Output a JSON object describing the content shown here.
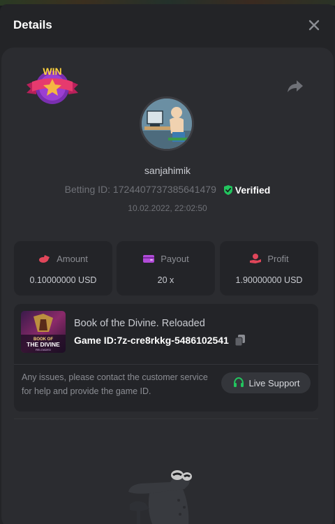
{
  "header": {
    "title": "Details"
  },
  "player": {
    "username": "sanjahimik",
    "betting_id_label": "Betting ID:",
    "betting_id": "1724407737385641479",
    "verified_label": "Verified",
    "timestamp": "10.02.2022, 22:02:50"
  },
  "stats": [
    {
      "label": "Amount",
      "value": "0.10000000 USD",
      "icon": "coins-icon",
      "color": "#e0465a"
    },
    {
      "label": "Payout",
      "value": "20 x",
      "icon": "wallet-icon",
      "color": "#b14bd8"
    },
    {
      "label": "Profit",
      "value": "1.90000000 USD",
      "icon": "hand-coin-icon",
      "color": "#e0465a"
    }
  ],
  "game": {
    "title": "Book of the Divine. Reloaded",
    "id_label": "Game ID:",
    "id_value": "7z-cre8rkkg-5486102541",
    "thumb_lines": [
      "BOOK OF",
      "THE DIVINE",
      "RELOADED"
    ]
  },
  "support": {
    "message": "Any issues, please contact the customer service for help and provide the game ID.",
    "button_label": "Live Support"
  },
  "badge": {
    "text": "WIN"
  },
  "colors": {
    "accent_green": "#22c55e",
    "background": "#232427",
    "card": "#2b2c30"
  }
}
